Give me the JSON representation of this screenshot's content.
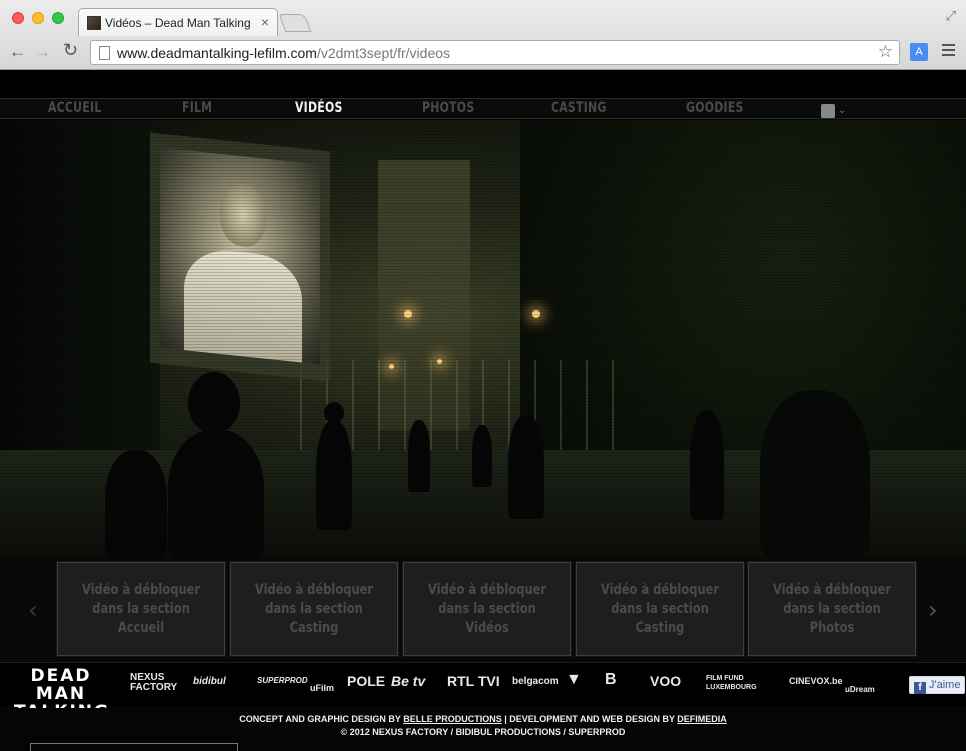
{
  "browser": {
    "tab_title": "Vidéos – Dead Man Talking",
    "url_host": "www.deadmantalking-lefilm.com",
    "url_path": "/v2dmt3sept/fr/videos",
    "icons": [
      "back-icon",
      "forward-icon",
      "reload-icon",
      "page-icon",
      "star-icon",
      "translate-icon",
      "menu-icon",
      "fullscreen-icon"
    ]
  },
  "nav": {
    "items": [
      {
        "label": "ACCUEIL",
        "active": false
      },
      {
        "label": "FILM",
        "active": false
      },
      {
        "label": "VIDÉOS",
        "active": true
      },
      {
        "label": "PHOTOS",
        "active": false
      },
      {
        "label": "CASTING",
        "active": false
      },
      {
        "label": "GOODIES",
        "active": false
      }
    ]
  },
  "videos": [
    {
      "label": "Vidéo à débloquer\ndans la section Accueil"
    },
    {
      "label": "Vidéo à débloquer\ndans la section Casting"
    },
    {
      "label": "Vidéo à débloquer\ndans la section Vidéos"
    },
    {
      "label": "Vidéo à débloquer\ndans la section Casting"
    },
    {
      "label": "Vidéo à débloquer\ndans la section Photos"
    }
  ],
  "footer": {
    "brand": "DEAD MAN\nTALKING",
    "partners": [
      "NEXUS FACTORY",
      "bidibul",
      "SUPERPROD",
      "uFilm",
      "POLE",
      "Be tv",
      "RTL TVI",
      "belgacom",
      "VOO",
      "FILM FUND LUXEMBOURG",
      "CINEVOX.be",
      "uDream"
    ],
    "like_label": "J'aime",
    "credit_prefix": "CONCEPT AND GRAPHIC DESIGN BY ",
    "credit_link1": "BELLE PRODUCTIONS",
    "credit_middle": " | DEVELOPMENT AND WEB DESIGN BY ",
    "credit_link2": "DEFIMEDIA",
    "copyright": "© 2012 NEXUS FACTORY / BIDIBUL PRODUCTIONS / SUPERPROD"
  }
}
